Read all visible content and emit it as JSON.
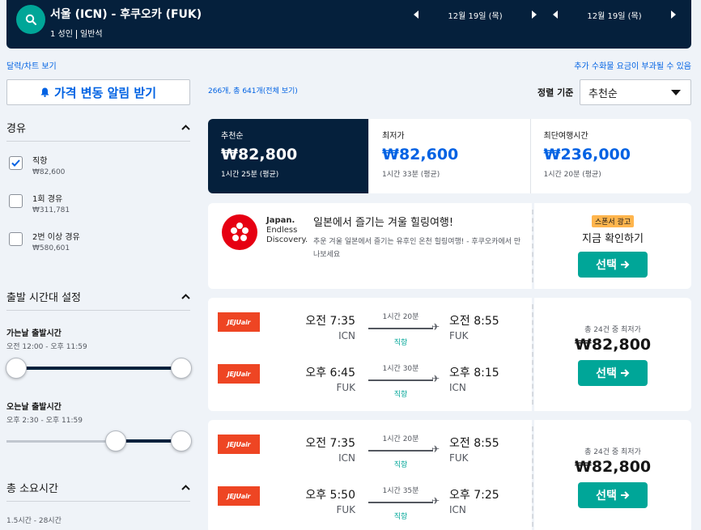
{
  "header": {
    "route": "서울 (ICN) - 후쿠오카 (FUK)",
    "passengers": "1 성인",
    "cabin": "일반석",
    "depart_date": "12월 19일 (목)",
    "return_date": "12월 19일 (목)"
  },
  "links": {
    "calendar": "달력/차트 보기",
    "fee_notice": "추가 수화물 요금이 부과될 수 있음"
  },
  "sidebar": {
    "alert_button": "가격 변동 알림 받기",
    "stops_title": "경유",
    "stops": [
      {
        "label": "직항",
        "price": "₩82,600",
        "checked": true
      },
      {
        "label": "1회 경유",
        "price": "₩311,781",
        "checked": false
      },
      {
        "label": "2번 이상 경유",
        "price": "₩580,601",
        "checked": false
      }
    ],
    "time_title": "출발 시간대 설정",
    "outbound_title": "가는날 출발시간",
    "outbound_range": "오전 12:00 - 오후 11:59",
    "return_title": "오는날 출발시간",
    "return_range": "오후 2:30 - 오후 11:59",
    "duration_title": "총 소요시간",
    "duration_range": "1.5시간 - 28시간"
  },
  "results": {
    "count": "266개, 총 641개(전체 보기)",
    "sort_label": "정렬 기준",
    "sort_value": "추천순"
  },
  "tabs": [
    {
      "label": "추천순",
      "price": "₩82,800",
      "sub": "1시간 25분 (평균)"
    },
    {
      "label": "최저가",
      "price": "₩82,600",
      "sub": "1시간 33분 (평균)"
    },
    {
      "label": "최단여행시간",
      "price": "₩236,000",
      "sub": "1시간 20분 (평균)"
    }
  ],
  "ad": {
    "brand_line1": "Japan.",
    "brand_line2": "Endless",
    "brand_line3": "Discovery.",
    "title": "일본에서 즐기는 겨울 힐링여행!",
    "desc": "추운 겨울 일본에서 즐기는 유후인 온천 힐링여행! - 후쿠오카에서 만나보세요",
    "badge": "스폰서 광고",
    "cta": "지금 확인하기",
    "button": "선택"
  },
  "flights": [
    {
      "caption": "총 24건 중 최저가",
      "price": "₩82,800",
      "button": "선택",
      "legs": [
        {
          "airline": "JEJUair",
          "dep_time": "오전 7:35",
          "dep_code": "ICN",
          "duration": "1시간 20분",
          "stops": "직항",
          "arr_time": "오전 8:55",
          "arr_code": "FUK"
        },
        {
          "airline": "JEJUair",
          "dep_time": "오후 6:45",
          "dep_code": "FUK",
          "duration": "1시간 30분",
          "stops": "직항",
          "arr_time": "오후 8:15",
          "arr_code": "ICN"
        }
      ]
    },
    {
      "caption": "총 24건 중 최저가",
      "price": "₩82,800",
      "button": "선택",
      "legs": [
        {
          "airline": "JEJUair",
          "dep_time": "오전 7:35",
          "dep_code": "ICN",
          "duration": "1시간 20분",
          "stops": "직항",
          "arr_time": "오전 8:55",
          "arr_code": "FUK"
        },
        {
          "airline": "JEJUair",
          "dep_time": "오후 5:50",
          "dep_code": "FUK",
          "duration": "1시간 35분",
          "stops": "직항",
          "arr_time": "오후 7:25",
          "arr_code": "ICN"
        }
      ]
    }
  ],
  "colors": {
    "navy": "#05203c",
    "teal": "#00a698",
    "link": "#0062e3",
    "badge": "#ffb54d",
    "airline": "#ee4523"
  }
}
